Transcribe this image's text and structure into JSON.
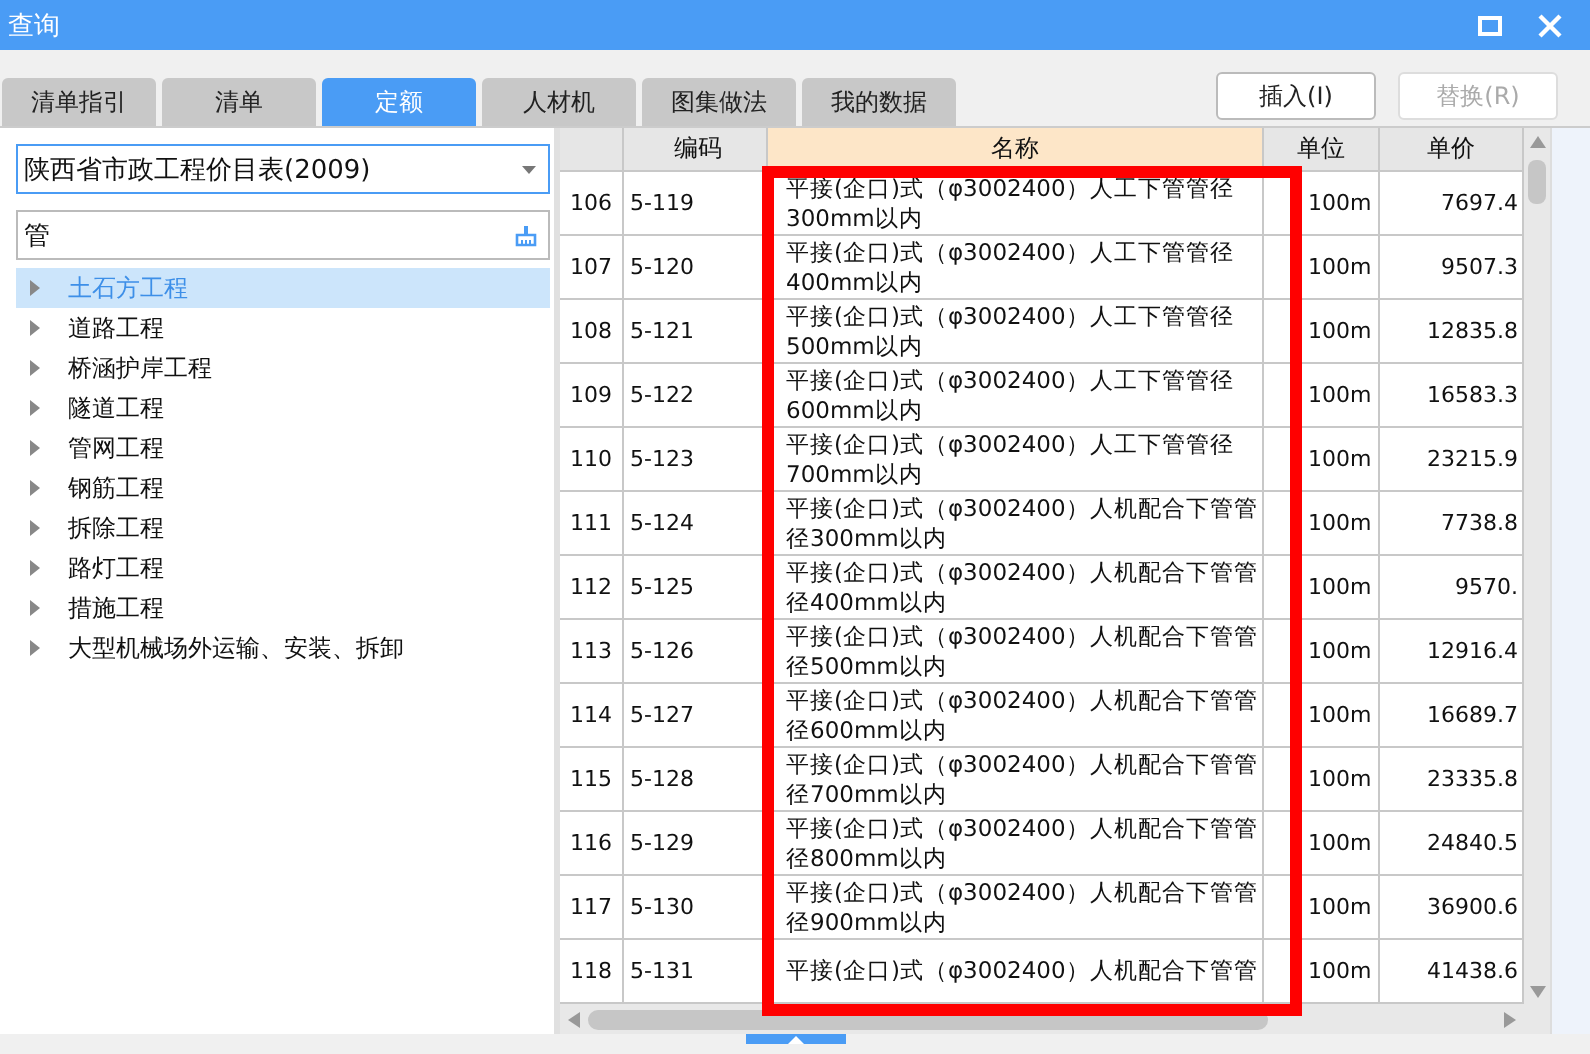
{
  "window": {
    "title": "查询"
  },
  "tabs": [
    {
      "label": "清单指引",
      "selected": false
    },
    {
      "label": "清单",
      "selected": false
    },
    {
      "label": "定额",
      "selected": true
    },
    {
      "label": "人材机",
      "selected": false
    },
    {
      "label": "图集做法",
      "selected": false
    },
    {
      "label": "我的数据",
      "selected": false
    }
  ],
  "buttons": [
    {
      "label": "插入(I)",
      "disabled": false
    },
    {
      "label": "替换(R)",
      "disabled": true
    }
  ],
  "library_select": {
    "value": "陕西省市政工程价目表(2009)"
  },
  "search": {
    "value": "管"
  },
  "tree": [
    {
      "label": "土石方工程",
      "selected": true
    },
    {
      "label": "道路工程",
      "selected": false
    },
    {
      "label": "桥涵护岸工程",
      "selected": false
    },
    {
      "label": "隧道工程",
      "selected": false
    },
    {
      "label": "管网工程",
      "selected": false
    },
    {
      "label": "钢筋工程",
      "selected": false
    },
    {
      "label": "拆除工程",
      "selected": false
    },
    {
      "label": "路灯工程",
      "selected": false
    },
    {
      "label": "措施工程",
      "selected": false
    },
    {
      "label": "大型机械场外运输、安装、拆卸",
      "selected": false
    }
  ],
  "table": {
    "columns": [
      "编码",
      "名称",
      "单位",
      "单价"
    ],
    "rows": [
      {
        "num": "106",
        "code": "5-119",
        "name_lines": [
          "平接(企口)式（φ3002400）人工下管管径",
          "300mm以内"
        ],
        "unit": "100m",
        "price": "7697.4"
      },
      {
        "num": "107",
        "code": "5-120",
        "name_lines": [
          "平接(企口)式（φ3002400）人工下管管径",
          "400mm以内"
        ],
        "unit": "100m",
        "price": "9507.3"
      },
      {
        "num": "108",
        "code": "5-121",
        "name_lines": [
          "平接(企口)式（φ3002400）人工下管管径",
          "500mm以内"
        ],
        "unit": "100m",
        "price": "12835.8"
      },
      {
        "num": "109",
        "code": "5-122",
        "name_lines": [
          "平接(企口)式（φ3002400）人工下管管径",
          "600mm以内"
        ],
        "unit": "100m",
        "price": "16583.3"
      },
      {
        "num": "110",
        "code": "5-123",
        "name_lines": [
          "平接(企口)式（φ3002400）人工下管管径",
          "700mm以内"
        ],
        "unit": "100m",
        "price": "23215.9"
      },
      {
        "num": "111",
        "code": "5-124",
        "name_lines": [
          "平接(企口)式（φ3002400）人机配合下管管",
          "径300mm以内"
        ],
        "unit": "100m",
        "price": "7738.8"
      },
      {
        "num": "112",
        "code": "5-125",
        "name_lines": [
          "平接(企口)式（φ3002400）人机配合下管管",
          "径400mm以内"
        ],
        "unit": "100m",
        "price": "9570."
      },
      {
        "num": "113",
        "code": "5-126",
        "name_lines": [
          "平接(企口)式（φ3002400）人机配合下管管",
          "径500mm以内"
        ],
        "unit": "100m",
        "price": "12916.4"
      },
      {
        "num": "114",
        "code": "5-127",
        "name_lines": [
          "平接(企口)式（φ3002400）人机配合下管管",
          "径600mm以内"
        ],
        "unit": "100m",
        "price": "16689.7"
      },
      {
        "num": "115",
        "code": "5-128",
        "name_lines": [
          "平接(企口)式（φ3002400）人机配合下管管",
          "径700mm以内"
        ],
        "unit": "100m",
        "price": "23335.8"
      },
      {
        "num": "116",
        "code": "5-129",
        "name_lines": [
          "平接(企口)式（φ3002400）人机配合下管管",
          "径800mm以内"
        ],
        "unit": "100m",
        "price": "24840.5"
      },
      {
        "num": "117",
        "code": "5-130",
        "name_lines": [
          "平接(企口)式（φ3002400）人机配合下管管",
          "径900mm以内"
        ],
        "unit": "100m",
        "price": "36900.6"
      },
      {
        "num": "118",
        "code": "5-131",
        "name_lines": [
          "平接(企口)式（φ3002400）人机配合下管管"
        ],
        "unit": "100m",
        "price": "41438.6"
      }
    ]
  }
}
